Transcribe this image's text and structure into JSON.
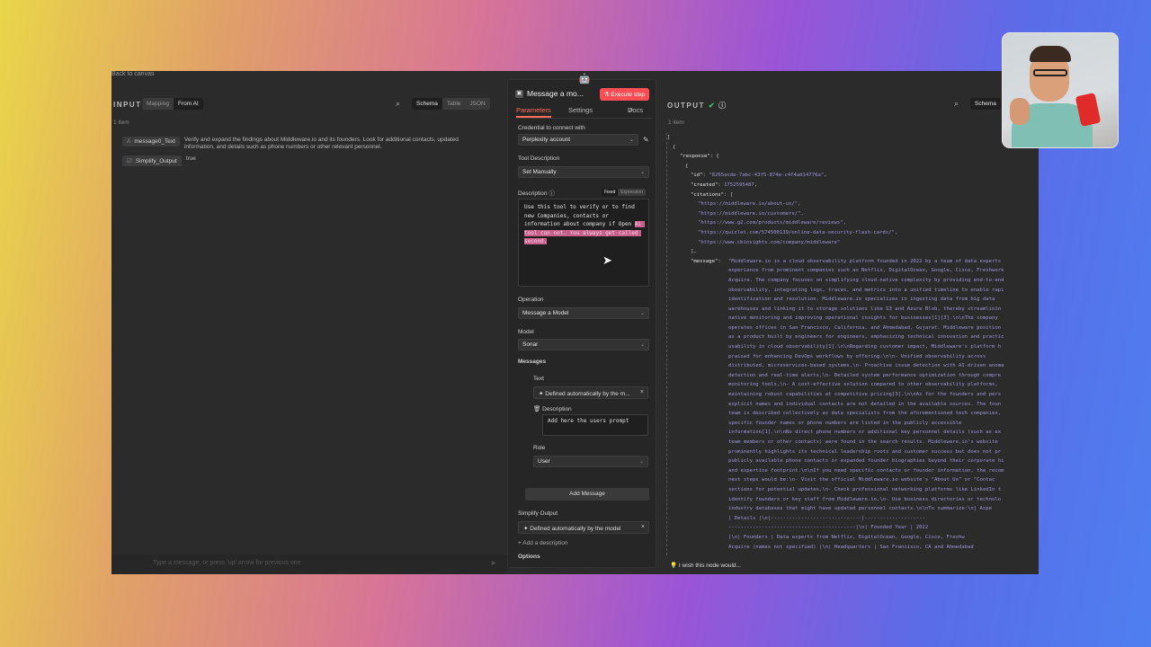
{
  "app": {
    "back_link": "Back to canvas"
  },
  "input": {
    "title": "INPUT",
    "seg": [
      "Mapping",
      "From AI"
    ],
    "views": [
      "Schema",
      "Table",
      "JSON"
    ],
    "item_count": "1 item",
    "fields": [
      {
        "type": "A",
        "name": "message0_Text",
        "value": "Verify and expand the findings about Middleware.io and its founders. Look for additional contacts, updated information, and details such as phone numbers or other relevant personnel."
      },
      {
        "type": "☑",
        "name": "Simplify_Output",
        "value": "true"
      }
    ],
    "chat_placeholder": "Type a message, or press 'up' arrow for previous one"
  },
  "modal": {
    "title": "Message a mo...",
    "execute": "Execute step",
    "tabs": [
      "Parameters",
      "Settings",
      "Docs"
    ],
    "credential_label": "Credential to connect with",
    "credential_value": "Perplexity account",
    "tool_desc_label": "Tool Description",
    "tool_desc_value": "Set Manually",
    "description_label": "Description",
    "fx": [
      "Fixed",
      "Expression"
    ],
    "description_text": "Use this tool to verify or to find new Companies, contacts or information about company if Open ",
    "description_highlight": "Ai tool can not. You always get called second.",
    "operation_label": "Operation",
    "operation_value": "Message a Model",
    "model_label": "Model",
    "model_value": "Sonar",
    "messages_label": "Messages",
    "text_label": "Text",
    "text_value": "Defined automatically by the m...",
    "desc2_label": "Description",
    "desc2_value": "Add here the users prompt",
    "role_label": "Role",
    "role_value": "User",
    "add_message": "Add Message",
    "simplify_label": "Simplify Output",
    "simplify_value": "Defined automatically by the model",
    "add_description": "+ Add a description",
    "options_label": "Options"
  },
  "output": {
    "title": "OUTPUT",
    "view": "Schema",
    "item_count": "1 item",
    "id": "\"8265acde-7abc-43f5-874e-c4f4ad14776a\"",
    "created": "1752595487",
    "citations": [
      "\"https://middleware.io/about-us/\",",
      "\"https://middleware.io/customers/\",",
      "\"https://www.g2.com/products/middleware/reviews\",",
      "\"https://quizlet.com/574500139/online-data-security-flash-cards/\",",
      "\"https://www.cbinsights.com/company/middleware\""
    ],
    "message_lines": [
      "\"Middleware.io is a cloud observability platform founded in 2022 by a team of data experts",
      "experience from prominent companies such as Netflix, DigitalOcean, Google, Cisco, Freshwork",
      "Acquire. The company focuses on simplifying cloud-native complexity by providing end-to-end",
      "observability, integrating logs, traces, and metrics into a unified timeline to enable rapi",
      "identification and resolution. Middleware.io specializes in ingesting data from big data",
      "warehouses and linking it to storage solutions like S3 and Azure Blob, thereby streamlinin",
      "native monitoring and improving operational insights for businesses[1][3].\\n\\nThe company",
      "operates offices in San Francisco, California, and Ahmedabad, Gujarat. Middleware position",
      "as a product built by engineers for engineers, emphasizing technical innovation and practic",
      "usability in cloud observability[1].\\n\\nRegarding customer impact, Middleware's platform h",
      "praised for enhancing DevOps workflows by offering:\\n\\n- Unified observability across",
      "distributed, microservices-based systems,\\n- Proactive issue detection with AI-driven anoma",
      "detection and real-time alerts,\\n- Detailed system performance optimization through compre",
      "monitoring tools,\\n- A cost-effective solution compared to other observability platforms,",
      "maintaining robust capabilities at competitive pricing[3].\\n\\nAs for the founders and pers",
      "explicit names and individual contacts are not detailed in the available sources. The foun",
      "team is described collectively as data specialists from the aforementioned tech companies,",
      "specific founder names or phone numbers are listed in the publicly accessible",
      "information[1].\\n\\nNo direct phone numbers or additional key personnel details (such as ex",
      "team members or other contacts) were found in the search results. Middleware.io's website",
      "prominently highlights its technical leadership roots and customer success but does not pr",
      "publicly available phone contacts or expanded founder biographies beyond their corporate hi",
      "and expertise footprint.\\n\\nIf you need specific contacts or founder information, the recom",
      "next steps would be:\\n- Visit the official Middleware.io website's \"About Us\" or \"Contac",
      "sections for potential updates,\\n- Check professional networking platforms like LinkedIn t",
      "identify founders or key staff from Middleware.io,\\n- Use business directories or technolo",
      "industry databases that might have updated personnel contacts.\\n\\nTo summarize:\\n| Aspe",
      "| Details                        |\\n|------------------------------|--------------------",
      "------------------------------------------|\\n| Founded Year              | 2022",
      "|\\n| Founders              | Data experts from Netflix, DigitalOcean, Google, Cisco, Freshw",
      "Acquire (names not specified) |\\n| Headquarters          | San Francisco, CA and Ahmedabad"
    ],
    "footer": "I wish this node would..."
  }
}
